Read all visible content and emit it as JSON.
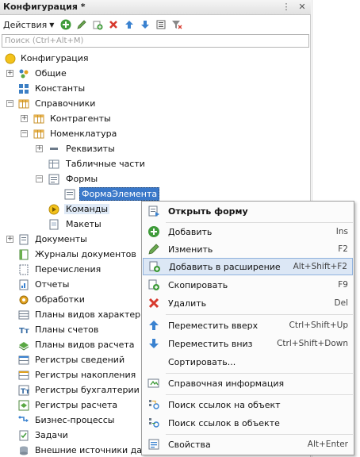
{
  "window": {
    "title": "Конфигурация *"
  },
  "toolbar": {
    "actions_label": "Действия"
  },
  "search": {
    "placeholder": "Поиск (Ctrl+Alt+M)"
  },
  "tree": [
    "Конфигурация",
    "Общие",
    "Константы",
    "Справочники",
    "Контрагенты",
    "Номенклатура",
    "Реквизиты",
    "Табличные части",
    "Формы",
    "ФормаЭлемента",
    "Команды",
    "Макеты",
    "Документы",
    "Журналы документов",
    "Перечисления",
    "Отчеты",
    "Обработки",
    "Планы видов характеристик",
    "Планы счетов",
    "Планы видов расчета",
    "Регистры сведений",
    "Регистры накопления",
    "Регистры бухгалтерии",
    "Регистры расчета",
    "Бизнес-процессы",
    "Задачи",
    "Внешние источники данных"
  ],
  "context_menu": {
    "open_form": "Открыть форму",
    "add": "Добавить",
    "add_key": "Ins",
    "edit": "Изменить",
    "edit_key": "F2",
    "add_ext": "Добавить в расширение",
    "add_ext_key": "Alt+Shift+F2",
    "copy": "Скопировать",
    "copy_key": "F9",
    "delete": "Удалить",
    "delete_key": "Del",
    "move_up": "Переместить вверх",
    "move_up_key": "Ctrl+Shift+Up",
    "move_down": "Переместить вниз",
    "move_down_key": "Ctrl+Shift+Down",
    "sort": "Сортировать...",
    "ref_info": "Справочная информация",
    "find_refs_to": "Поиск ссылок на объект",
    "find_refs_in": "Поиск ссылок в объекте",
    "props": "Свойства",
    "props_key": "Alt+Enter"
  }
}
